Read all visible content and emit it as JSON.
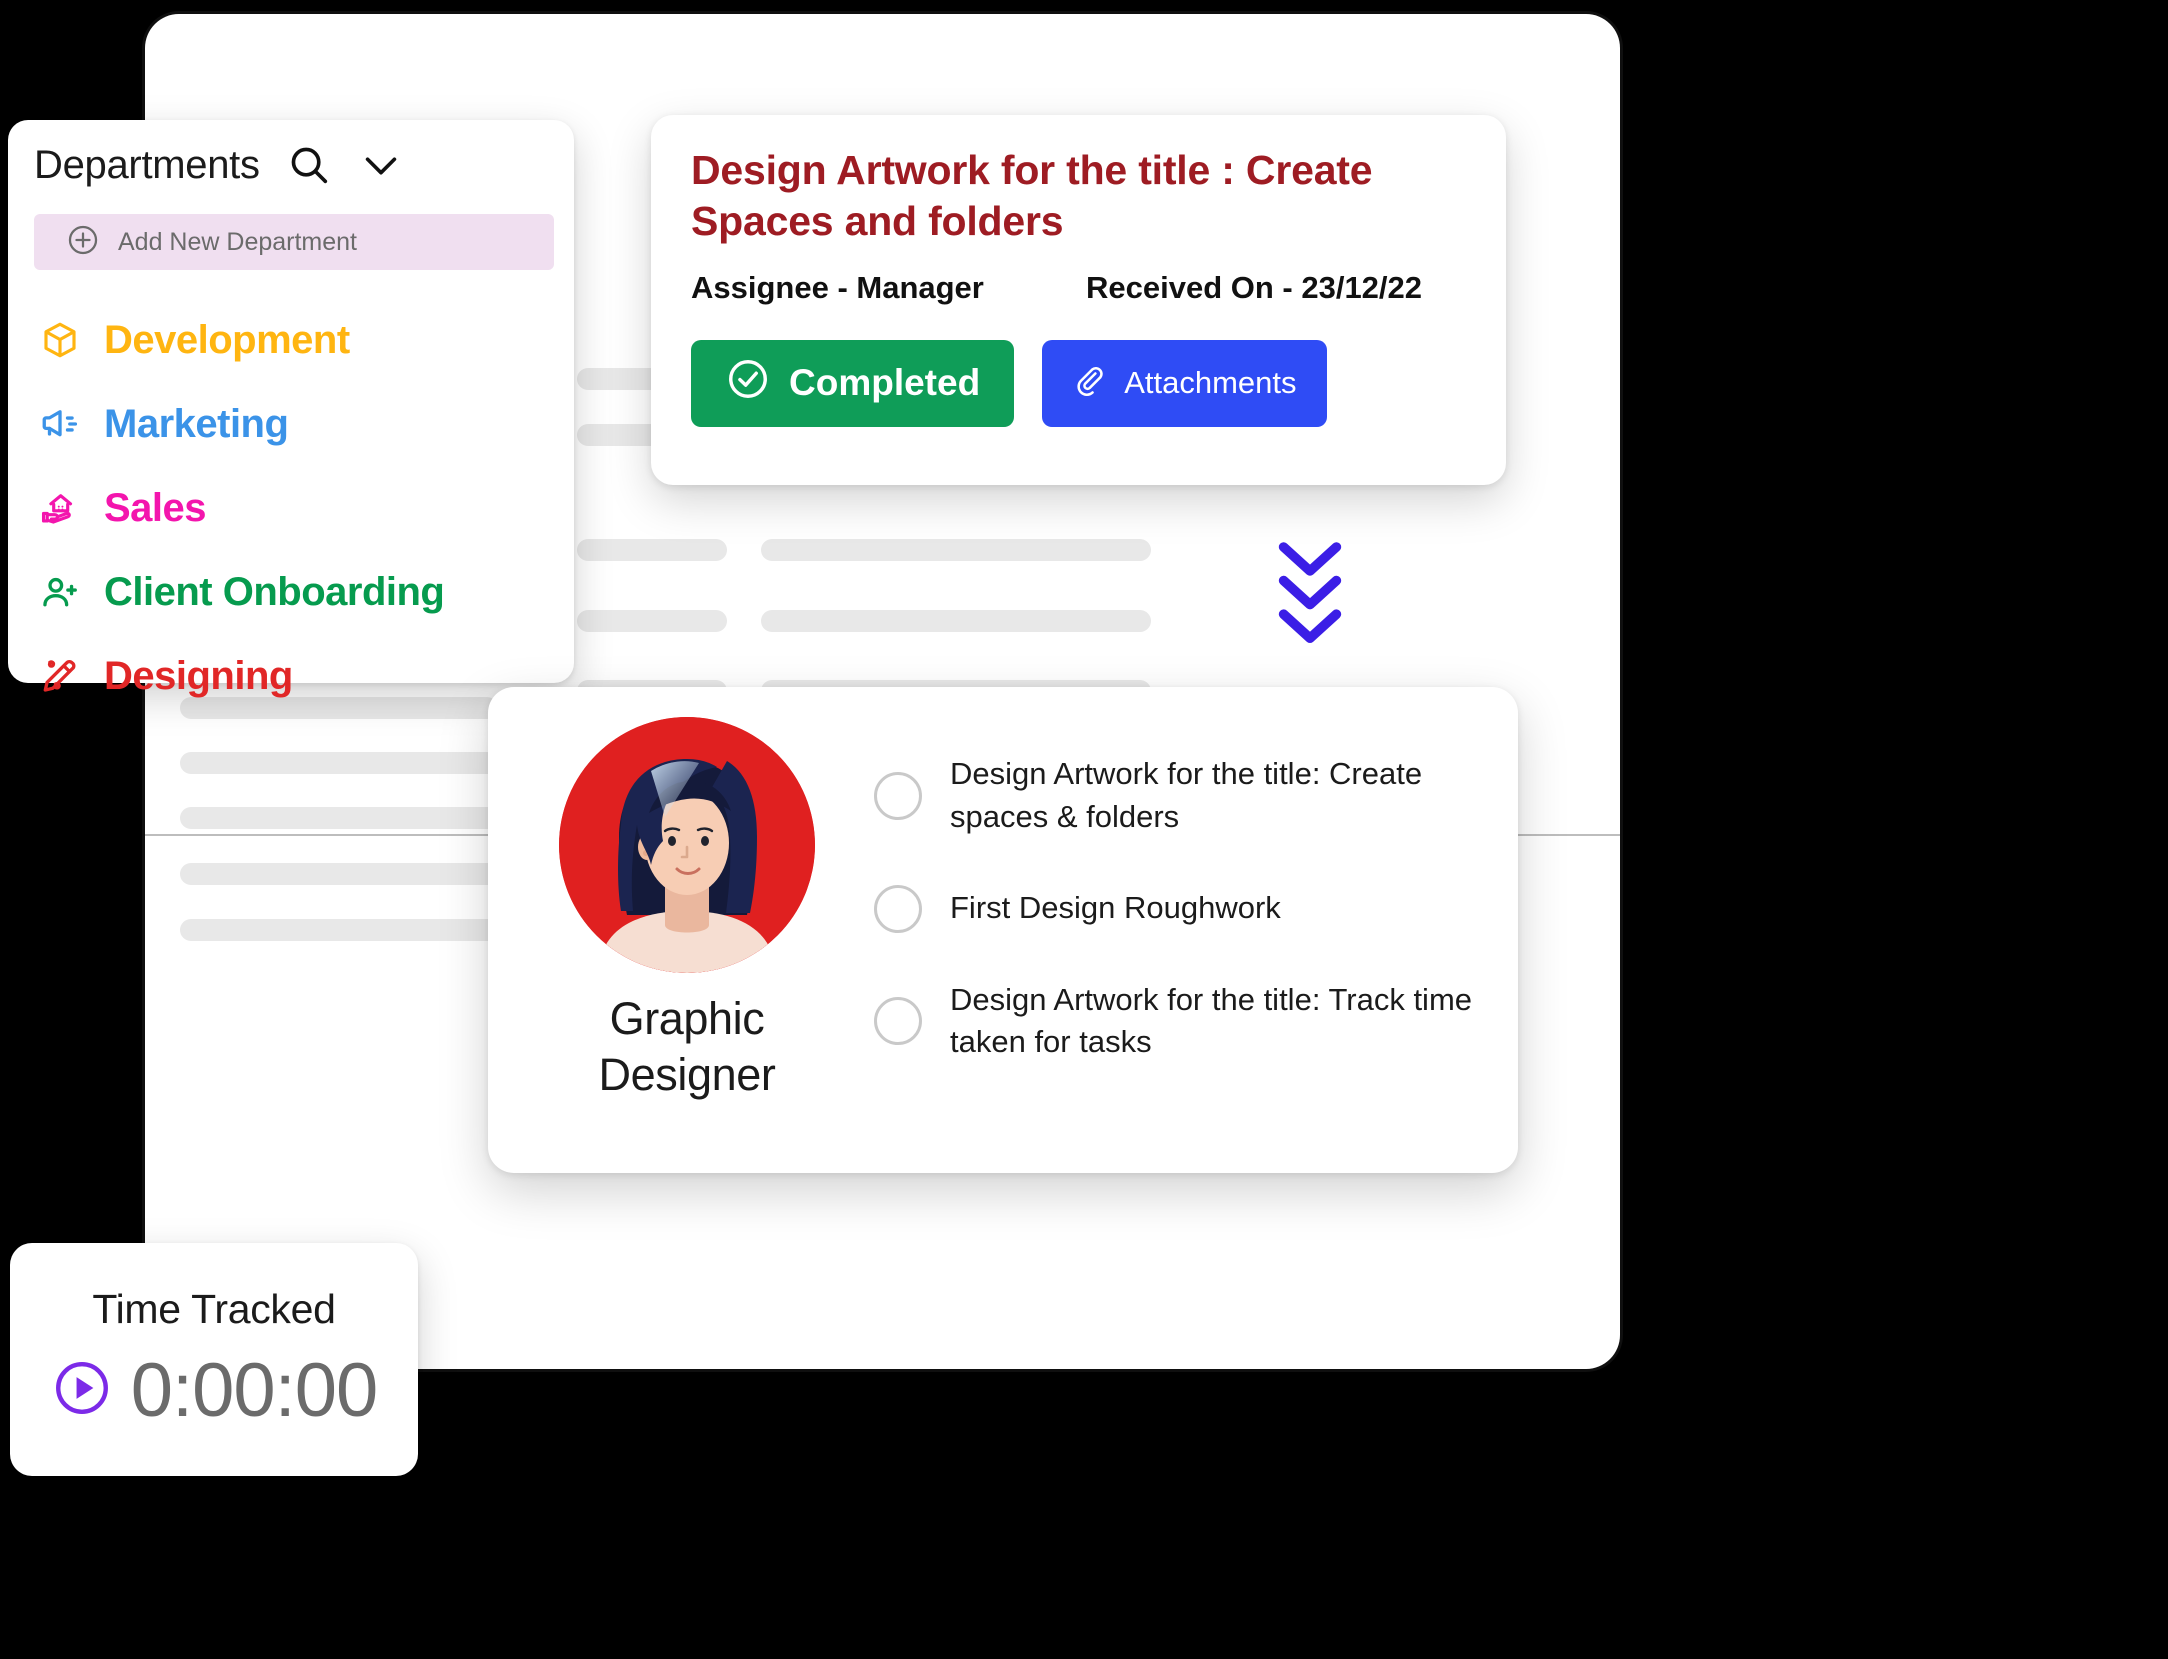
{
  "departments_panel": {
    "title": "Departments",
    "search_icon": "search-icon",
    "collapse_icon": "chevron-down-icon",
    "add_new": {
      "label": "Add New Department",
      "icon": "plus-circle-icon",
      "background": "#f0dff0"
    },
    "items": [
      {
        "label": "Development",
        "icon": "cube-icon",
        "color": "#ffb511"
      },
      {
        "label": "Marketing",
        "icon": "megaphone-icon",
        "color": "#3b93e8"
      },
      {
        "label": "Sales",
        "icon": "house-hand-icon",
        "color": "#f315ad"
      },
      {
        "label": "Client Onboarding",
        "icon": "user-plus-icon",
        "color": "#069b4e"
      },
      {
        "label": "Designing",
        "icon": "pen-ruler-icon",
        "color": "#e12727"
      }
    ]
  },
  "task_card": {
    "title": "Design Artwork for the title : Create Spaces and folders",
    "title_color": "#9e1c23",
    "assignee": "Assignee - Manager",
    "received_on": "Received On - 23/12/22",
    "buttons": [
      {
        "label": "Completed",
        "icon": "check-circle-icon",
        "color": "#0f9d58"
      },
      {
        "label": "Attachments",
        "icon": "paperclip-icon",
        "color": "#2f4cf5"
      }
    ]
  },
  "person_card": {
    "role_line1": "Graphic",
    "role_line2": "Designer",
    "avatar": "female-avatar",
    "avatar_background": "#e02020",
    "tasks": [
      {
        "label": "Design Artwork for the title: Create spaces & folders",
        "checked": false
      },
      {
        "label": "First Design Roughwork",
        "checked": false
      },
      {
        "label": "Design Artwork for the title: Track time taken for tasks",
        "checked": false
      }
    ]
  },
  "time_tracker": {
    "label": "Time Tracked",
    "value": "0:00:00",
    "play_icon": "play-circle-icon",
    "accent": "#7c2ae8"
  },
  "decoration": {
    "chevron_stack_icon": "double-chevron-down-icon",
    "chevron_color": "#3b1ee6"
  }
}
